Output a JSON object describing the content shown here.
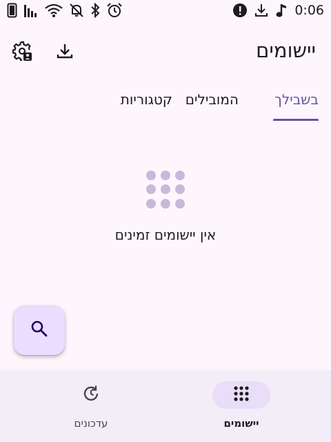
{
  "status_bar": {
    "time": "0:06",
    "left_icons": [
      "sim-card-icon",
      "signal-bars-icon",
      "wifi-icon",
      "notifications-off-icon",
      "bluetooth-icon",
      "alarm-icon"
    ],
    "right_icons": [
      "alert-circle-icon",
      "download-icon",
      "music-note-icon"
    ]
  },
  "top_bar": {
    "title": "יישומים",
    "actions": [
      "settings-admin-icon",
      "download-icon"
    ]
  },
  "tabs": [
    {
      "label": "בשבילך",
      "active": true
    },
    {
      "label": "המובילים",
      "active": false
    },
    {
      "label": "קטגוריות",
      "active": false
    }
  ],
  "empty_state": {
    "icon": "apps-grid-icon",
    "message": "אין יישומים זמינים"
  },
  "fab": {
    "icon": "search-icon"
  },
  "bottom_nav": {
    "items": [
      {
        "label": "יישומים",
        "icon": "apps-grid-icon",
        "active": true
      },
      {
        "label": "עדכונים",
        "icon": "update-history-icon",
        "active": false
      }
    ]
  },
  "colors": {
    "background": "#fdf7fd",
    "accent": "#6750a4",
    "fab_background": "#eaddff",
    "nav_background": "#f3edf7",
    "nav_pill": "#e8def8",
    "empty_icon": "#c9b8da"
  }
}
